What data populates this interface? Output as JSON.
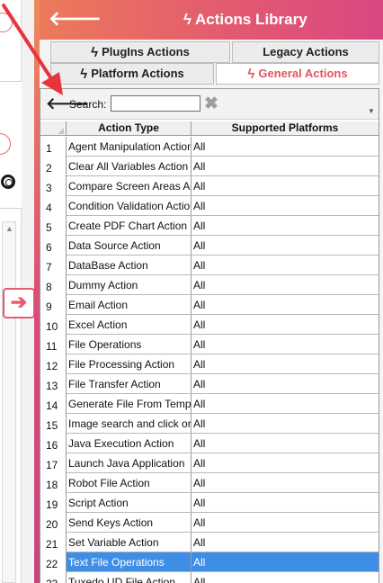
{
  "header": {
    "title": "Actions Library",
    "back_icon": "arrow-left-icon",
    "title_icon": "bolt-icon"
  },
  "tabs": {
    "plugins": "PlugIns Actions",
    "legacy": "Legacy Actions",
    "platform": "Platform Actions",
    "general": "General Actions",
    "active": "general"
  },
  "search": {
    "label": "Search:",
    "value": "",
    "placeholder": ""
  },
  "table": {
    "columns": [
      "Action Type",
      "Supported Platforms"
    ],
    "rows": [
      {
        "num": "1",
        "type": "Agent Manipulation Action",
        "platform": "All"
      },
      {
        "num": "2",
        "type": "Clear All Variables Action",
        "platform": "All"
      },
      {
        "num": "3",
        "type": "Compare Screen Areas Action",
        "platform": "All"
      },
      {
        "num": "4",
        "type": "Condition Validation Action",
        "platform": "All"
      },
      {
        "num": "5",
        "type": "Create PDF Chart Action",
        "platform": "All"
      },
      {
        "num": "6",
        "type": "Data Source Action",
        "platform": "All"
      },
      {
        "num": "7",
        "type": "DataBase Action",
        "platform": "All"
      },
      {
        "num": "8",
        "type": "Dummy Action",
        "platform": "All"
      },
      {
        "num": "9",
        "type": "Email Action",
        "platform": "All"
      },
      {
        "num": "10",
        "type": "Excel Action",
        "platform": "All"
      },
      {
        "num": "11",
        "type": "File Operations",
        "platform": "All"
      },
      {
        "num": "12",
        "type": "File Processing Action",
        "platform": "All"
      },
      {
        "num": "13",
        "type": "File Transfer Action",
        "platform": "All"
      },
      {
        "num": "14",
        "type": "Generate File From Template",
        "platform": "All"
      },
      {
        "num": "15",
        "type": "Image search and click or",
        "platform": "All"
      },
      {
        "num": "16",
        "type": "Java Execution Action",
        "platform": "All"
      },
      {
        "num": "17",
        "type": "Launch Java Application",
        "platform": "All"
      },
      {
        "num": "18",
        "type": "Robot File Action",
        "platform": "All"
      },
      {
        "num": "19",
        "type": "Script Action",
        "platform": "All"
      },
      {
        "num": "20",
        "type": "Send Keys Action",
        "platform": "All"
      },
      {
        "num": "21",
        "type": "Set Variable Action",
        "platform": "All"
      },
      {
        "num": "22",
        "type": "Text File Operations",
        "platform": "All"
      },
      {
        "num": "23",
        "type": "Tuxedo UD File Action",
        "platform": "All"
      }
    ],
    "selected_row": "22"
  },
  "colors": {
    "header_start": "#ec7a5a",
    "header_end": "#d84882",
    "active_tab_text": "#e25462",
    "selection": "#3f8ee6",
    "annotation_arrow": "#e8353c"
  }
}
